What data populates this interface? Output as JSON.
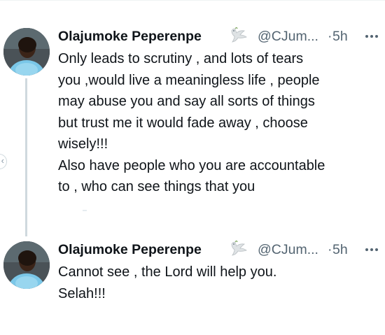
{
  "thread": {
    "tweets": [
      {
        "display_name": "Olajumoke Peperenpe",
        "badge_icon": "dove-icon",
        "handle": "@CJum...",
        "separator": "·",
        "timestamp": "5h",
        "more_icon": "more-icon",
        "avatar_icon": "avatar",
        "text_lines": [
          "Only leads to scrutiny , and lots of tears",
          "you ,would live a meaningless life , people",
          "may abuse you and say all sorts of things",
          "but trust me it would fade away , choose",
          "wisely!!!",
          "Also have people who you are accountable",
          "to , who can see things that you"
        ]
      },
      {
        "display_name": "Olajumoke Peperenpe",
        "badge_icon": "dove-icon",
        "handle": "@CJum...",
        "separator": "·",
        "timestamp": "5h",
        "more_icon": "more-icon",
        "avatar_icon": "avatar",
        "text_lines": [
          "Cannot see , the Lord will help you.",
          "Selah!!!"
        ]
      }
    ]
  },
  "colors": {
    "text_primary": "#0f1419",
    "text_secondary": "#536471",
    "thread_line": "#cfd9de"
  }
}
